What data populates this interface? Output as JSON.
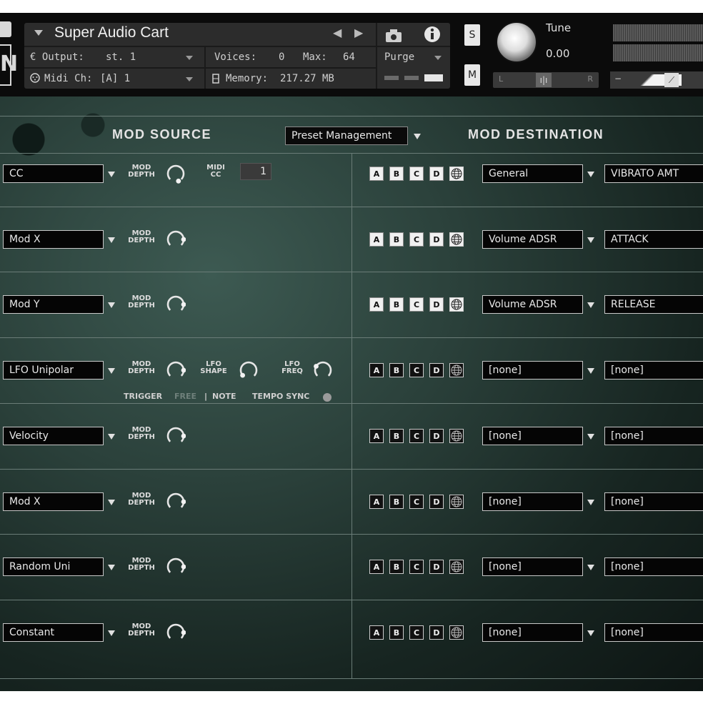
{
  "instrument": {
    "title": "Super Audio Cart",
    "output_label": "€ Output:",
    "output_value": "st. 1",
    "midi_label": "Midi Ch:",
    "midi_value": "[A]  1",
    "voices_label": "Voices:",
    "voices_value": "0",
    "max_label": "Max:",
    "max_value": "64",
    "memory_label": "Memory:",
    "memory_value": "217.27 MB",
    "purge_label": "Purge",
    "solo_label": "S",
    "mute_label": "M",
    "tune_label": "Tune",
    "tune_value": "0.00",
    "pan_left": "L",
    "pan_right": "R",
    "prev_arrow": "◀",
    "next_arrow": "▶"
  },
  "headers": {
    "mod_source": "MOD SOURCE",
    "preset": "Preset Management",
    "mod_destination": "MOD DESTINATION"
  },
  "labels": {
    "mod": "MOD",
    "depth": "DEPTH",
    "midi": "MIDI",
    "cc": "CC",
    "lfo": "LFO",
    "shape": "SHAPE",
    "freq": "FREQ",
    "trigger": "TRIGGER",
    "free": "FREE",
    "divider": "|",
    "note": "NOTE",
    "tempo_sync": "TEMPO SYNC",
    "a": "A",
    "b": "B",
    "c": "C",
    "d": "D"
  },
  "midi_cc_value": "1",
  "rows": [
    {
      "source": "CC",
      "dest_category": "General",
      "dest_param": "VIBRATO AMT"
    },
    {
      "source": "Mod X",
      "dest_category": "Volume ADSR",
      "dest_param": "ATTACK"
    },
    {
      "source": "Mod Y",
      "dest_category": "Volume ADSR",
      "dest_param": "RELEASE"
    },
    {
      "source": "LFO Unipolar",
      "dest_category": "[none]",
      "dest_param": "[none]"
    },
    {
      "source": "Velocity",
      "dest_category": "[none]",
      "dest_param": "[none]"
    },
    {
      "source": "Mod X",
      "dest_category": "[none]",
      "dest_param": "[none]"
    },
    {
      "source": "Random Uni",
      "dest_category": "[none]",
      "dest_param": "[none]"
    },
    {
      "source": "Constant",
      "dest_category": "[none]",
      "dest_param": "[none]"
    }
  ]
}
